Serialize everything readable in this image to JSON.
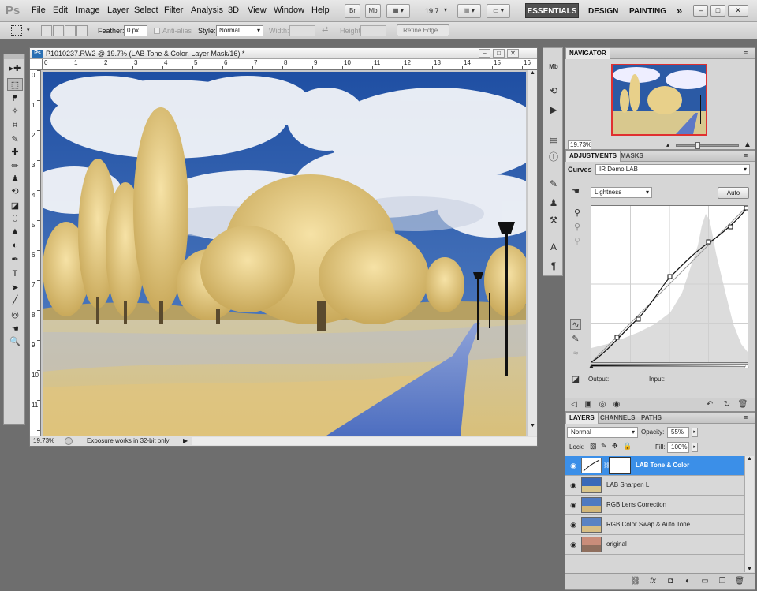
{
  "menubar": {
    "logo": "Ps",
    "items": [
      "File",
      "Edit",
      "Image",
      "Layer",
      "Select",
      "Filter",
      "Analysis",
      "3D",
      "View",
      "Window",
      "Help"
    ],
    "bridge_btn": "Br",
    "minibridge_btn": "Mb",
    "zoom_value": "19.7",
    "workspaces": {
      "active": "ESSENTIALS",
      "design": "DESIGN",
      "painting": "PAINTING",
      "more": "»"
    },
    "window_controls": [
      "–",
      "□",
      "✕"
    ]
  },
  "options": {
    "feather_label": "Feather:",
    "feather_value": "0 px",
    "antialias_label": "Anti-alias",
    "style_label": "Style:",
    "style_value": "Normal",
    "width_label": "Width:",
    "height_label": "Height:",
    "refine_edge": "Refine Edge..."
  },
  "tools": [
    "▸✚",
    "⬚",
    "ᖰ",
    "✧",
    "⌗",
    "✎",
    "✚",
    "✏",
    "♟",
    "⟲",
    "◪",
    "⬯",
    "▲",
    "◐",
    "✒",
    "T",
    "➤",
    "╱",
    "◎",
    "☚",
    "🔍"
  ],
  "document": {
    "title": "P1010237.RW2 @ 19.7% (LAB Tone & Color, Layer Mask/16) *",
    "badge": "Ps",
    "controls": [
      "–",
      "□",
      "✕"
    ],
    "ruler_h": [
      "0",
      "1",
      "2",
      "3",
      "4",
      "5",
      "6",
      "7",
      "8",
      "9",
      "10",
      "11",
      "12",
      "13",
      "14",
      "15",
      "16"
    ],
    "ruler_v": [
      "0",
      "1",
      "2",
      "3",
      "4",
      "5",
      "6",
      "7",
      "8",
      "9",
      "10",
      "11"
    ],
    "zoom": "19.73%",
    "status": "Exposure works in 32-bit only"
  },
  "navigator": {
    "tab": "NAVIGATOR",
    "zoom": "19.73%"
  },
  "adjustments": {
    "tabs": [
      "ADJUSTMENTS",
      "MASKS"
    ],
    "curves_label": "Curves",
    "preset": "IR Demo LAB",
    "channel": "Lightness",
    "auto": "Auto",
    "output_label": "Output:",
    "input_label": "Input:"
  },
  "layers": {
    "tabs": [
      "LAYERS",
      "CHANNELS",
      "PATHS"
    ],
    "blend_mode": "Normal",
    "opacity_label": "Opacity:",
    "opacity": "55%",
    "lock_label": "Lock:",
    "fill_label": "Fill:",
    "fill": "100%",
    "items": [
      {
        "name": "LAB Tone & Color",
        "selected": true
      },
      {
        "name": "LAB Sharpen L",
        "selected": false
      },
      {
        "name": "RGB Lens Correction",
        "selected": false
      },
      {
        "name": "RGB Color Swap & Auto Tone",
        "selected": false
      },
      {
        "name": "original",
        "selected": false
      }
    ]
  },
  "colors": {
    "selection": "#3b8fe8",
    "sky": "#2b5aa5",
    "foliage": "#e8d08a",
    "nav_frame": "#e03030"
  }
}
